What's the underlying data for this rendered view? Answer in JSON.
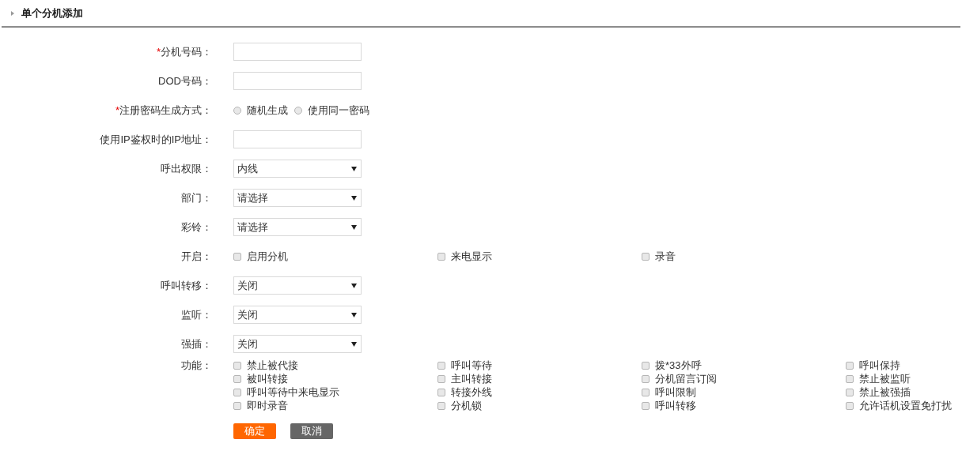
{
  "header": {
    "title": "单个分机添加"
  },
  "fields": [
    {
      "kind": "text",
      "marker": "*",
      "label": "分机号码："
    },
    {
      "kind": "text",
      "label": "DOD号码："
    },
    {
      "kind": "radio",
      "marker": "*",
      "label": "注册密码生成方式：",
      "options": [
        {
          "label": "随机生成",
          "selected": false
        },
        {
          "label": "使用同一密码",
          "selected": false
        }
      ]
    },
    {
      "kind": "text",
      "label": "使用IP鉴权时的IP地址："
    },
    {
      "kind": "select",
      "label": "呼出权限：",
      "value": "内线"
    },
    {
      "kind": "select",
      "label": "部门：",
      "value": "请选择"
    },
    {
      "kind": "select",
      "label": "彩铃：",
      "value": "请选择"
    },
    {
      "kind": "checkbox",
      "label": "开启：",
      "options": [
        {
          "label": "启用分机",
          "checked": false
        },
        {
          "label": "来电显示",
          "checked": false
        },
        {
          "label": "录音",
          "checked": false
        }
      ]
    },
    {
      "kind": "select",
      "label": "呼叫转移：",
      "value": "关闭"
    },
    {
      "kind": "select",
      "label": "监听：",
      "value": "关闭"
    },
    {
      "kind": "select",
      "label": "强插：",
      "value": "关闭"
    },
    {
      "kind": "checkbox",
      "label": "功能：",
      "options": [
        {
          "label": "禁止被代接",
          "checked": false
        },
        {
          "label": "呼叫等待",
          "checked": false
        },
        {
          "label": "拨*33外呼",
          "checked": false
        },
        {
          "label": "呼叫保持",
          "checked": false
        },
        {
          "label": "被叫转接",
          "checked": false
        },
        {
          "label": "主叫转接",
          "checked": false
        },
        {
          "label": "分机留言订阅",
          "checked": false
        },
        {
          "label": "禁止被监听",
          "checked": false
        },
        {
          "label": "呼叫等待中来电显示",
          "checked": false
        },
        {
          "label": "转接外线",
          "checked": false
        },
        {
          "label": "呼叫限制",
          "checked": false
        },
        {
          "label": "禁止被强插",
          "checked": false
        },
        {
          "label": "即时录音",
          "checked": false
        },
        {
          "label": "分机锁",
          "checked": false
        },
        {
          "label": "呼叫转移",
          "checked": false
        },
        {
          "label": "允许话机设置免打扰",
          "checked": false
        }
      ]
    }
  ],
  "buttons": [
    {
      "kind": "primary",
      "label": "确定"
    },
    {
      "kind": "secondary",
      "label": "取消"
    }
  ]
}
